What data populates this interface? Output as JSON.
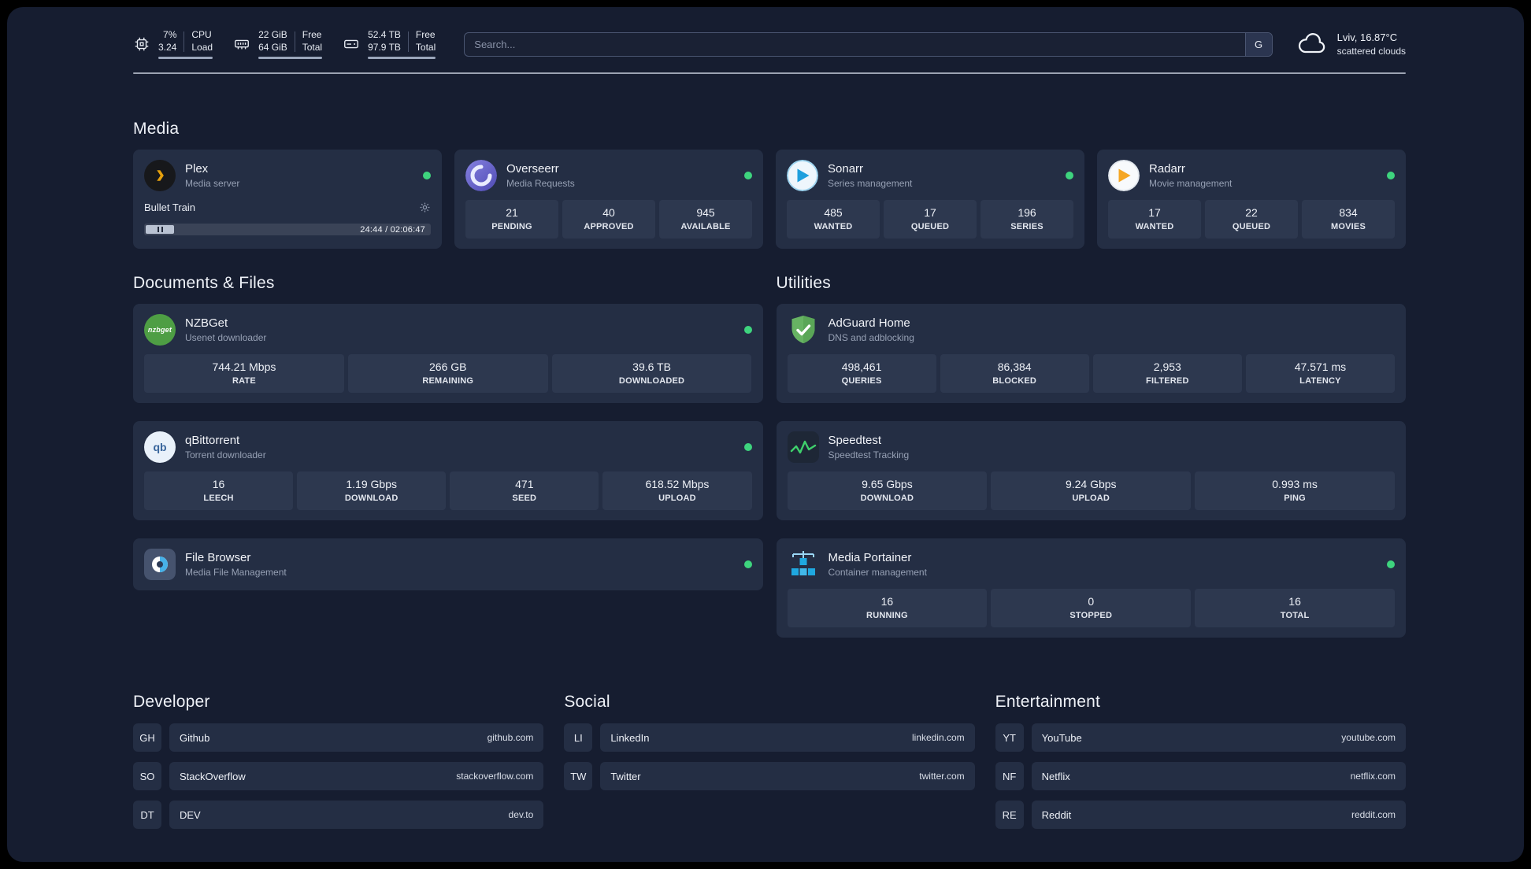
{
  "colors": {
    "status_online": "#3ed47e",
    "accent_plex": "#e5a00d",
    "accent_sonarr": "#28a9e0",
    "accent_radarr": "#f5a623",
    "accent_adguard": "#67b363",
    "accent_speedtest": "#3fd06c",
    "accent_portainer": "#1fa8e0"
  },
  "topbar": {
    "system": [
      {
        "icon": "cpu-icon",
        "value": "7%",
        "sub": "3.24",
        "label_top": "CPU",
        "label_bottom": "Load"
      },
      {
        "icon": "memory-icon",
        "value": "22 GiB",
        "sub": "64 GiB",
        "label_top": "Free",
        "label_bottom": "Total"
      },
      {
        "icon": "disk-icon",
        "value": "52.4 TB",
        "sub": "97.9 TB",
        "label_top": "Free",
        "label_bottom": "Total"
      }
    ],
    "search": {
      "placeholder": "Search...",
      "engine_label": "G"
    },
    "weather": {
      "location": "Lviv, 16.87°C",
      "condition": "scattered clouds"
    }
  },
  "media": {
    "title": "Media",
    "plex": {
      "name": "Plex",
      "subtitle": "Media server",
      "now_playing": "Bullet Train",
      "time_display": "24:44 / 02:06:47"
    },
    "overseerr": {
      "name": "Overseerr",
      "subtitle": "Media Requests",
      "stats": [
        {
          "value": "21",
          "label": "PENDING"
        },
        {
          "value": "40",
          "label": "APPROVED"
        },
        {
          "value": "945",
          "label": "AVAILABLE"
        }
      ]
    },
    "sonarr": {
      "name": "Sonarr",
      "subtitle": "Series management",
      "stats": [
        {
          "value": "485",
          "label": "WANTED"
        },
        {
          "value": "17",
          "label": "QUEUED"
        },
        {
          "value": "196",
          "label": "SERIES"
        }
      ]
    },
    "radarr": {
      "name": "Radarr",
      "subtitle": "Movie management",
      "stats": [
        {
          "value": "17",
          "label": "WANTED"
        },
        {
          "value": "22",
          "label": "QUEUED"
        },
        {
          "value": "834",
          "label": "MOVIES"
        }
      ]
    }
  },
  "documents": {
    "title": "Documents & Files",
    "nzbget": {
      "name": "NZBGet",
      "subtitle": "Usenet downloader",
      "icon_text": "nzbget",
      "stats": [
        {
          "value": "744.21 Mbps",
          "label": "RATE"
        },
        {
          "value": "266 GB",
          "label": "REMAINING"
        },
        {
          "value": "39.6 TB",
          "label": "DOWNLOADED"
        }
      ]
    },
    "qbittorrent": {
      "name": "qBittorrent",
      "subtitle": "Torrent downloader",
      "icon_text": "qb",
      "stats": [
        {
          "value": "16",
          "label": "LEECH"
        },
        {
          "value": "1.19 Gbps",
          "label": "DOWNLOAD"
        },
        {
          "value": "471",
          "label": "SEED"
        },
        {
          "value": "618.52 Mbps",
          "label": "UPLOAD"
        }
      ]
    },
    "filebrowser": {
      "name": "File Browser",
      "subtitle": "Media File Management"
    }
  },
  "utilities": {
    "title": "Utilities",
    "adguard": {
      "name": "AdGuard Home",
      "subtitle": "DNS and adblocking",
      "stats": [
        {
          "value": "498,461",
          "label": "QUERIES"
        },
        {
          "value": "86,384",
          "label": "BLOCKED"
        },
        {
          "value": "2,953",
          "label": "FILTERED"
        },
        {
          "value": "47.571 ms",
          "label": "LATENCY"
        }
      ]
    },
    "speedtest": {
      "name": "Speedtest",
      "subtitle": "Speedtest Tracking",
      "stats": [
        {
          "value": "9.65 Gbps",
          "label": "DOWNLOAD"
        },
        {
          "value": "9.24 Gbps",
          "label": "UPLOAD"
        },
        {
          "value": "0.993 ms",
          "label": "PING"
        }
      ]
    },
    "portainer": {
      "name": "Media Portainer",
      "subtitle": "Container management",
      "stats": [
        {
          "value": "16",
          "label": "RUNNING"
        },
        {
          "value": "0",
          "label": "STOPPED"
        },
        {
          "value": "16",
          "label": "TOTAL"
        }
      ]
    }
  },
  "bookmarks": {
    "developer": {
      "title": "Developer",
      "items": [
        {
          "abbr": "GH",
          "name": "Github",
          "url": "github.com"
        },
        {
          "abbr": "SO",
          "name": "StackOverflow",
          "url": "stackoverflow.com"
        },
        {
          "abbr": "DT",
          "name": "DEV",
          "url": "dev.to"
        }
      ]
    },
    "social": {
      "title": "Social",
      "items": [
        {
          "abbr": "LI",
          "name": "LinkedIn",
          "url": "linkedin.com"
        },
        {
          "abbr": "TW",
          "name": "Twitter",
          "url": "twitter.com"
        }
      ]
    },
    "entertainment": {
      "title": "Entertainment",
      "items": [
        {
          "abbr": "YT",
          "name": "YouTube",
          "url": "youtube.com"
        },
        {
          "abbr": "NF",
          "name": "Netflix",
          "url": "netflix.com"
        },
        {
          "abbr": "RE",
          "name": "Reddit",
          "url": "reddit.com"
        }
      ]
    }
  }
}
